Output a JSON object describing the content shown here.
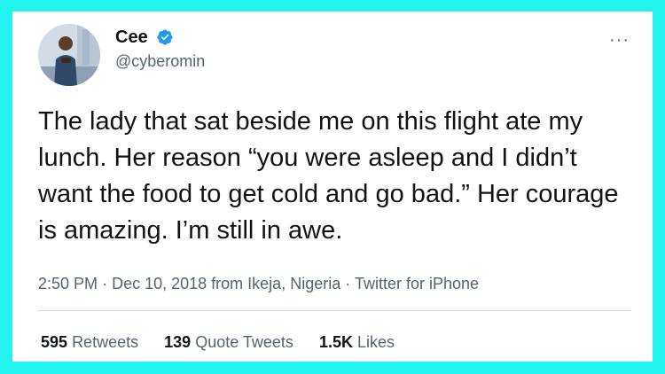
{
  "colors": {
    "background": "#22f3ee",
    "card": "#ffffff",
    "text": "#0f1419",
    "muted": "#536471",
    "verified": "#1d9bf0"
  },
  "user": {
    "display_name": "Cee",
    "handle": "@cyberomin",
    "verified_icon": "verified-badge-icon",
    "avatar_icon": "profile-photo"
  },
  "more_icon": "more-options-icon",
  "more_label": "···",
  "tweet": {
    "text": "The lady that sat beside me on this flight ate my lunch. Her reason “you were asleep and I didn’t want the food to get cold and go bad.” Her courage is amazing. I’m still in awe.",
    "time": "2:50 PM",
    "date": "Dec 10, 2018",
    "location": "from Ikeja, Nigeria",
    "source": "Twitter for iPhone",
    "separator": "·"
  },
  "stats": {
    "retweets": {
      "count": "595",
      "label": "Retweets"
    },
    "quote_tweets": {
      "count": "139",
      "label": "Quote Tweets"
    },
    "likes": {
      "count": "1.5K",
      "label": "Likes"
    }
  }
}
